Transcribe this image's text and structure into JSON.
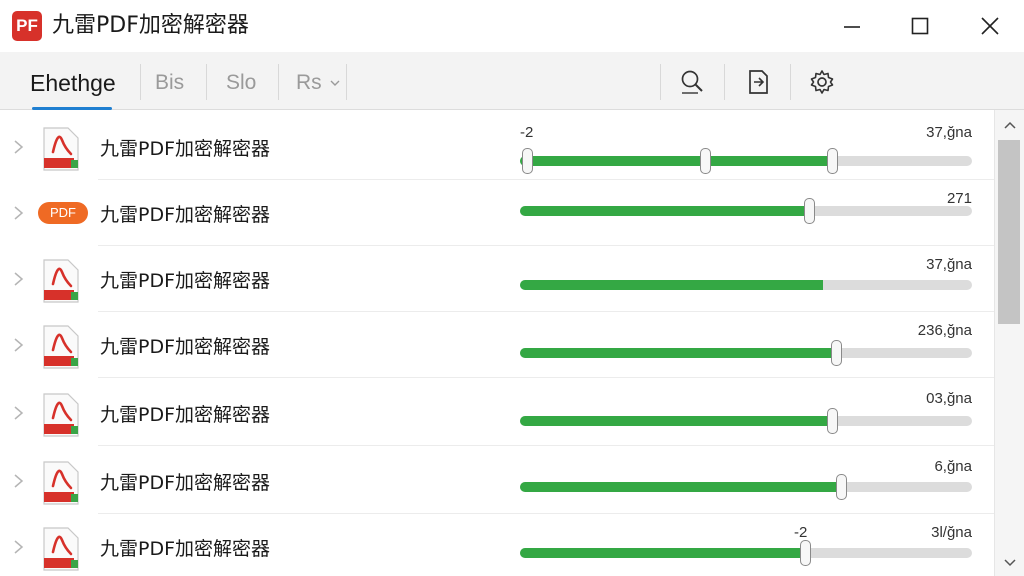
{
  "window": {
    "app_icon_text": "PF",
    "title": "九雷PDF加密解密器",
    "controls": [
      "minimize",
      "maximize",
      "close"
    ]
  },
  "toolbar": {
    "tabs": [
      {
        "label": "Ehethge",
        "active": true
      },
      {
        "label": "Bis",
        "active": false
      },
      {
        "label": "Slo",
        "active": false
      },
      {
        "label": "Rs",
        "active": false,
        "has_dropdown": true
      }
    ],
    "tools": [
      "search-icon",
      "export-icon",
      "gear-icon"
    ]
  },
  "rows": [
    {
      "name": "九雷PDF加密解密器",
      "icon": "pdf-file-icon",
      "value": "37,ğna",
      "note": "-2",
      "progress": 0.69,
      "range_start": 0.0,
      "thumbs": [
        0.0,
        0.41,
        0.69
      ]
    },
    {
      "name": "九雷PDF加密解密器",
      "icon": "pdf-badge-icon",
      "value": "271",
      "progress": 0.64,
      "thumbs": [
        0.64
      ]
    },
    {
      "name": "九雷PDF加密解密器",
      "icon": "pdf-file-icon",
      "value": "37,ğna",
      "progress": 0.67,
      "thumbs": []
    },
    {
      "name": "九雷PDF加密解密器",
      "icon": "pdf-file-icon",
      "value": "236,ğna",
      "progress": 0.7,
      "thumbs": [
        0.7
      ]
    },
    {
      "name": "九雷PDF加密解密器",
      "icon": "pdf-file-icon",
      "value": "03,ğna",
      "progress": 0.69,
      "thumbs": [
        0.69
      ]
    },
    {
      "name": "九雷PDF加密解密器",
      "icon": "pdf-file-icon",
      "value": "6,ğna",
      "progress": 0.71,
      "thumbs": [
        0.71
      ]
    },
    {
      "name": "九雷PDF加密解密器",
      "icon": "pdf-file-icon",
      "value": "3l/ğna",
      "note": "-2",
      "progress": 0.63,
      "thumbs": [
        0.63
      ]
    }
  ],
  "colors": {
    "accent": "#1f7fd1",
    "progress_fill": "#34a844",
    "track": "#dcdcdc",
    "app_icon": "#d7312a",
    "pdf_badge": "#ef6a24"
  }
}
